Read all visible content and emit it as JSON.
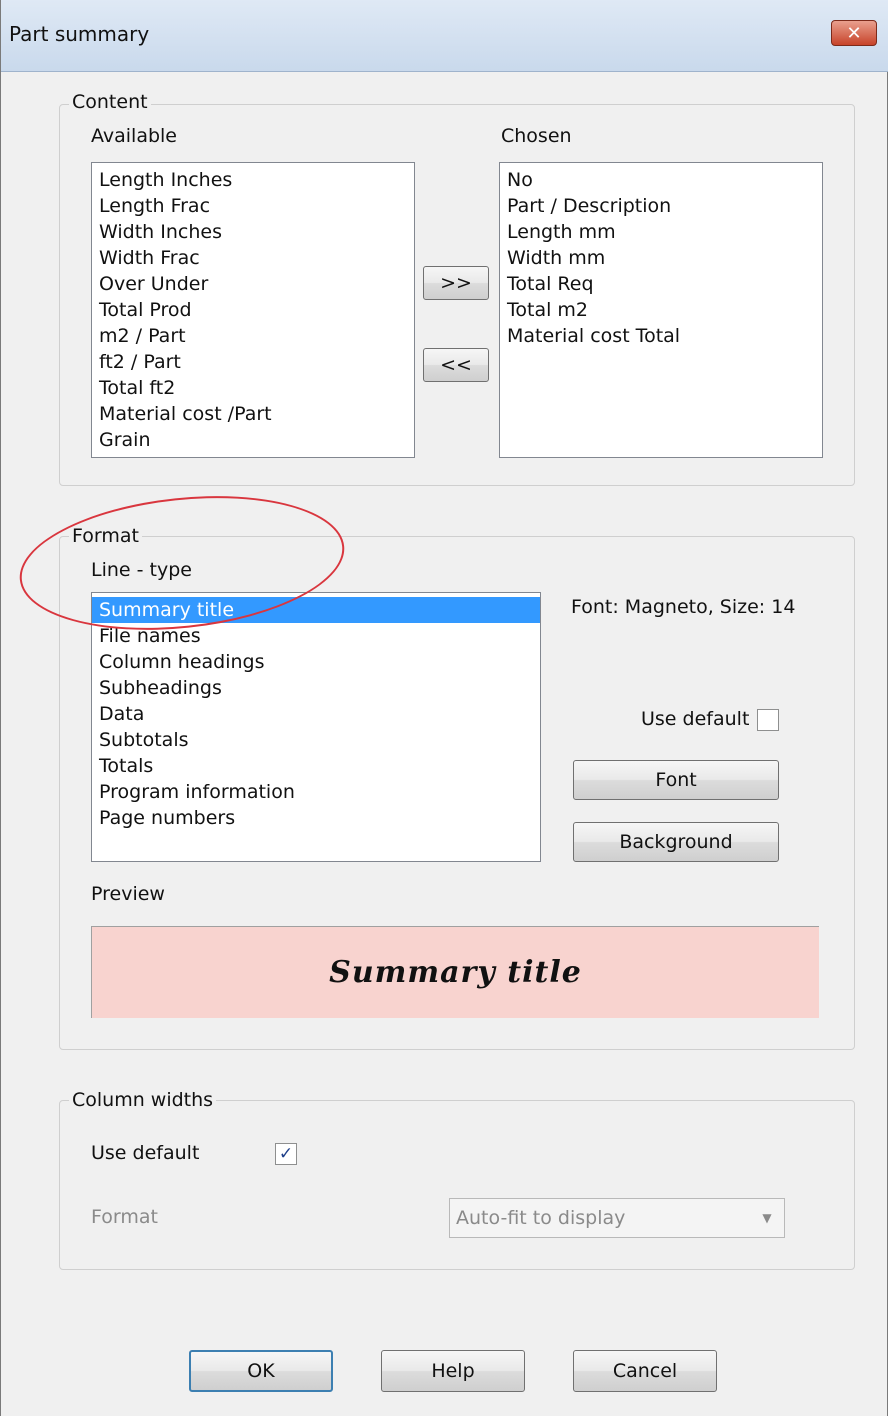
{
  "window": {
    "title": "Part summary",
    "close_glyph": "✕"
  },
  "content": {
    "group_label": "Content",
    "available_label": "Available",
    "chosen_label": "Chosen",
    "available_items": [
      "Length Inches",
      "Length Frac",
      "Width Inches",
      "Width Frac",
      "Over Under",
      "Total Prod",
      "m2 / Part",
      "ft2 / Part",
      "Total ft2",
      "Material cost /Part",
      "Grain"
    ],
    "chosen_items": [
      "No",
      "Part / Description",
      "Length mm",
      "Width mm",
      "Total Req",
      "Total m2",
      "Material cost Total"
    ],
    "add_button": ">>",
    "remove_button": "<<"
  },
  "format": {
    "group_label": "Format",
    "line_type_label": "Line - type",
    "line_types": [
      "Summary title",
      "File names",
      "Column headings",
      "Subheadings",
      "Data",
      "Subtotals",
      "Totals",
      "Program information",
      "Page numbers"
    ],
    "selected_index": 0,
    "font_info": "Font: Magneto, Size: 14",
    "use_default_label": "Use default",
    "use_default_checked": false,
    "font_button": "Font",
    "background_button": "Background",
    "preview_label": "Preview",
    "preview_text": "Summary title",
    "preview_bg_color": "#f8d3cf"
  },
  "column_widths": {
    "group_label": "Column widths",
    "use_default_label": "Use default",
    "use_default_checked": true,
    "check_glyph": "✓",
    "format_label": "Format",
    "format_value": "Auto-fit to display",
    "dropdown_glyph": "▼"
  },
  "buttons": {
    "ok": "OK",
    "help": "Help",
    "cancel": "Cancel"
  },
  "colors": {
    "selection": "#3399ff",
    "annotation": "#d9363e"
  }
}
